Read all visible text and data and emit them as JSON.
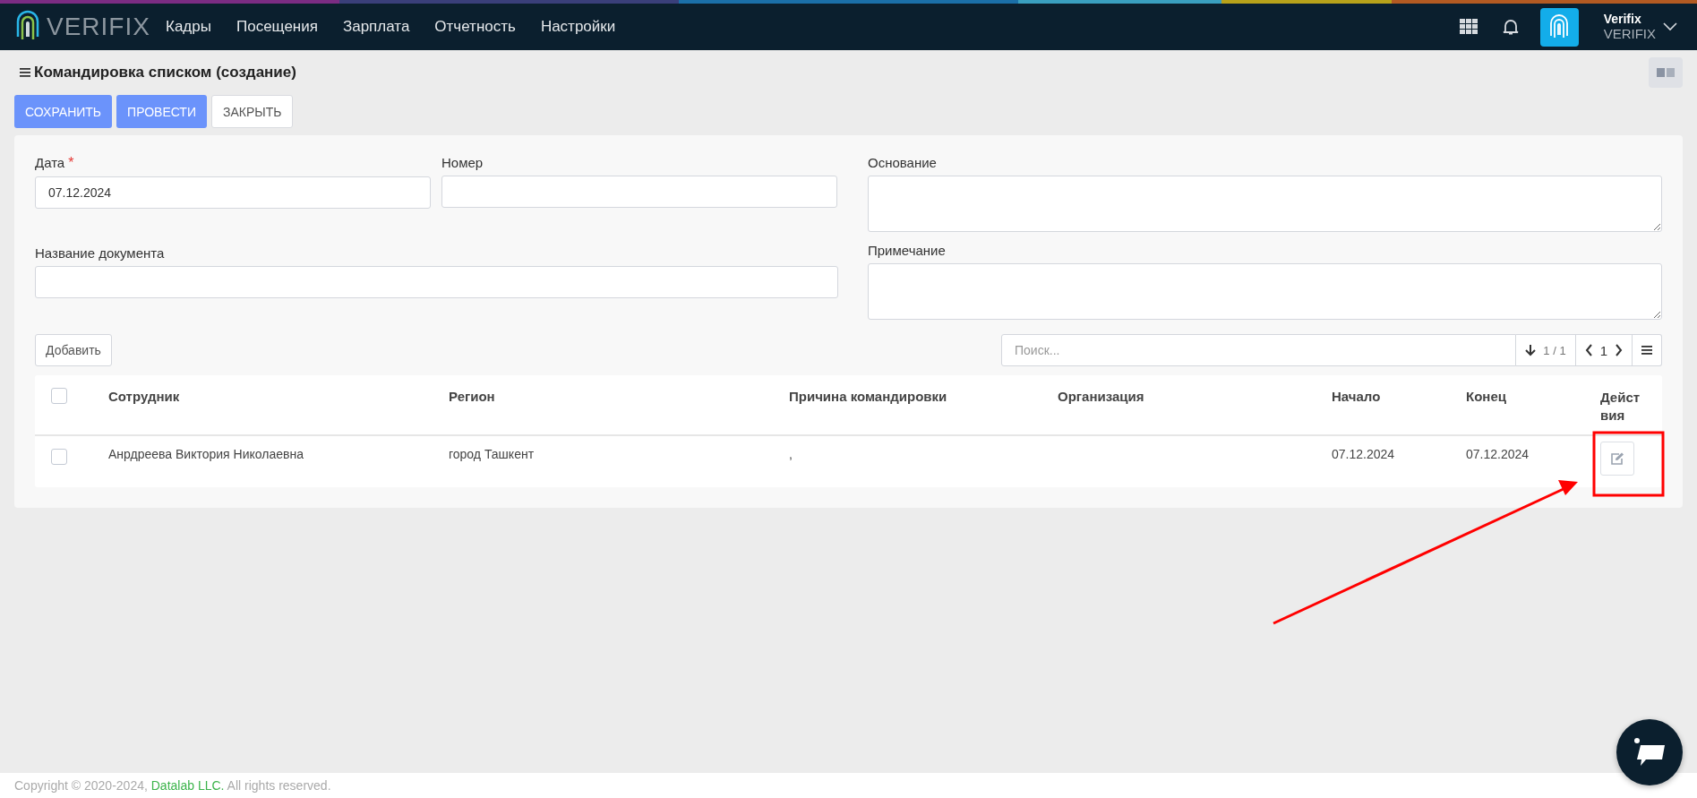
{
  "navbar": {
    "logo_text": "VERIFIX",
    "menu": [
      {
        "label": "Кадры"
      },
      {
        "label": "Посещения"
      },
      {
        "label": "Зарплата"
      },
      {
        "label": "Отчетность"
      },
      {
        "label": "Настройки"
      }
    ],
    "user": {
      "name": "Verifix",
      "company": "VERIFIX"
    }
  },
  "page": {
    "title": "Командировка списком (создание)",
    "buttons": [
      {
        "label": "СОХРАНИТЬ",
        "kind": "primary"
      },
      {
        "label": "ПРОВЕСТИ",
        "kind": "primary"
      },
      {
        "label": "ЗАКРЫТЬ",
        "kind": "default"
      }
    ]
  },
  "form": {
    "left_fields": [
      {
        "label": "Дата",
        "required_mark": "*",
        "value": "07.12.2024",
        "kind": "half"
      },
      {
        "label": "Номер",
        "kind": "half"
      },
      {
        "label": "Название документа",
        "kind": "full"
      }
    ],
    "right_fields": [
      {
        "label": "Основание"
      },
      {
        "label": "Примечание"
      }
    ]
  },
  "table": {
    "add_button": "Добавить",
    "search": {
      "placeholder": "Поиск..."
    },
    "sort_count": "1 / 1",
    "page": "1",
    "header_checked": false,
    "columns": [
      "Сотрудник",
      "Регион",
      "Причина командировки",
      "Организация",
      "Начало",
      "Конец",
      "Действия"
    ],
    "rows": [
      {
        "checked": false,
        "cells": [
          "Анрдреева Виктория Николаевна",
          "город Ташкент",
          ",",
          "",
          "07.12.2024",
          "07.12.2024"
        ]
      }
    ]
  },
  "footer": {
    "prefix": "Copyright © 2020-2024, ",
    "link": "Datalab LLC.",
    "suffix": " All rights reserved."
  }
}
